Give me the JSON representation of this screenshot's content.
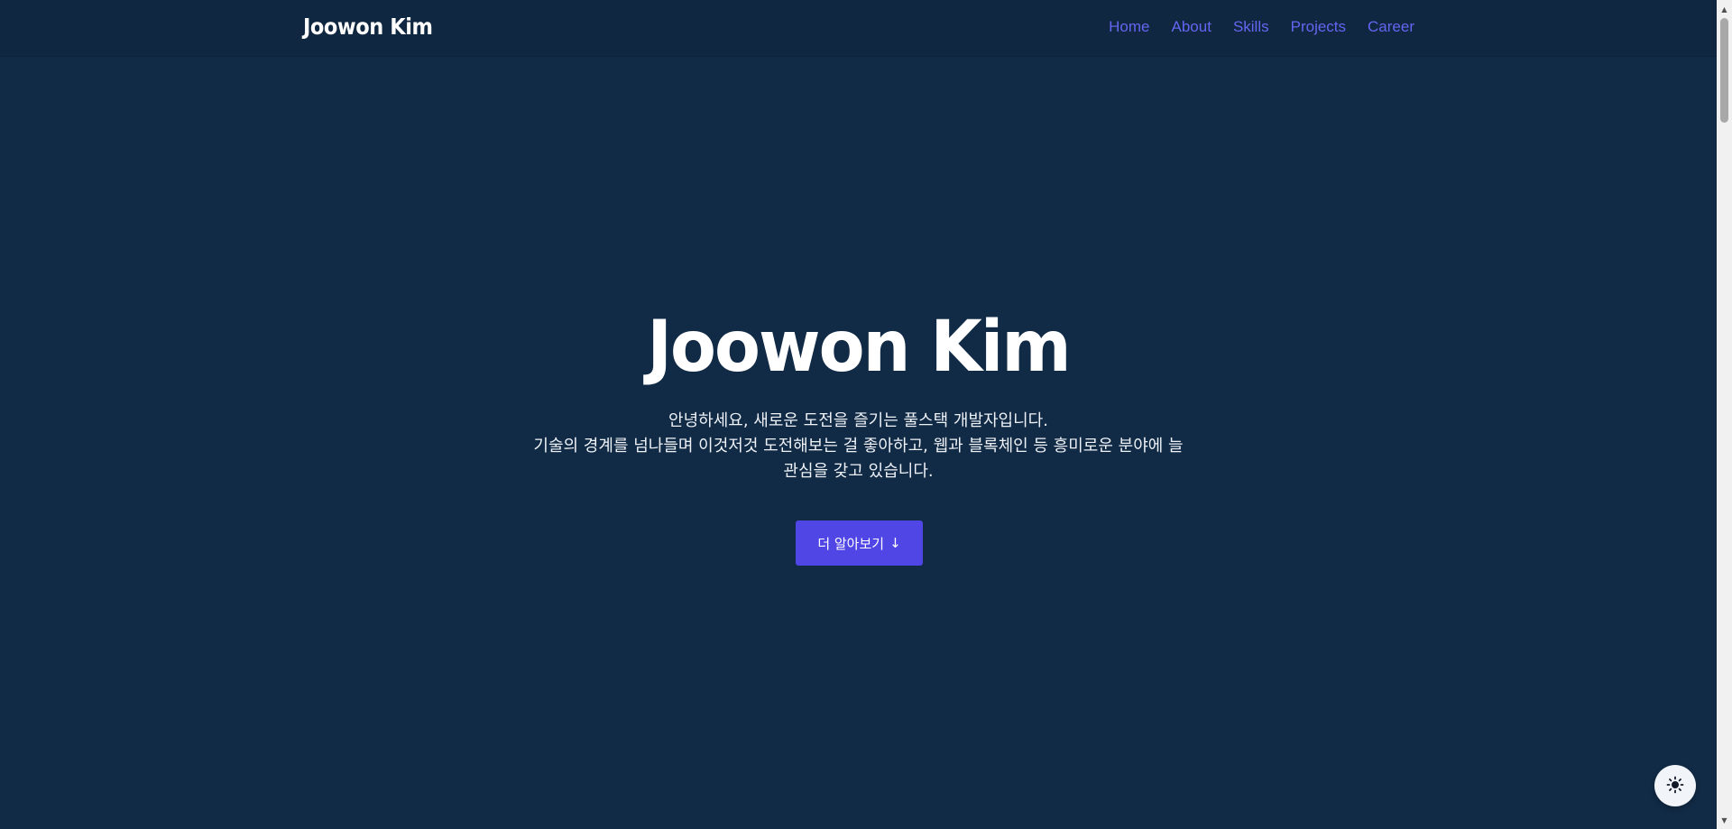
{
  "header": {
    "brand": "Joowon Kim",
    "nav": [
      {
        "label": "Home"
      },
      {
        "label": "About"
      },
      {
        "label": "Skills"
      },
      {
        "label": "Projects"
      },
      {
        "label": "Career"
      }
    ]
  },
  "hero": {
    "title": "Joowon Kim",
    "description_lines": [
      "안녕하세요, 새로운 도전을 즐기는 풀스택 개발자입니다.",
      "기술의 경계를 넘나들며 이것저것 도전해보는 걸 좋아하고, 웹과 블록체인 등 흥미로운 분야에 늘",
      "관심을 갖고 있습니다."
    ],
    "cta_label": "더 알아보기",
    "cta_icon": "arrow-down-icon",
    "cta_arrow": "↓"
  },
  "theme_toggle": {
    "icon": "sun-icon"
  },
  "colors": {
    "background": "#112a45",
    "header": "#0f2740",
    "accent": "#4f46e5",
    "nav_link": "#6366f1",
    "text": "#ffffff"
  }
}
